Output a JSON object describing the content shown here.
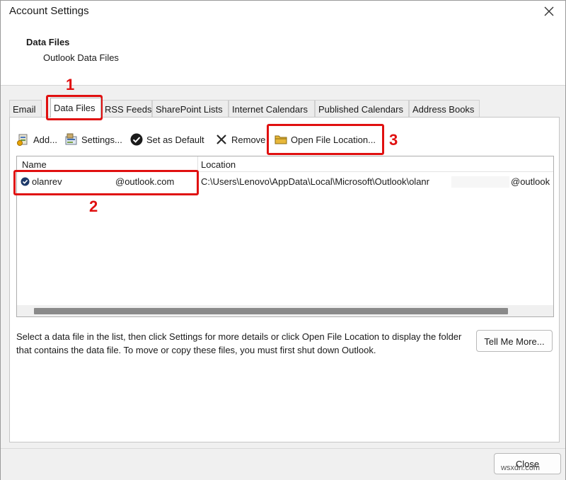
{
  "window": {
    "title": "Account Settings"
  },
  "header": {
    "title": "Data Files",
    "subtitle": "Outlook Data Files"
  },
  "tabs": [
    {
      "label": "Email"
    },
    {
      "label": "Data Files",
      "active": true
    },
    {
      "label": "RSS Feeds"
    },
    {
      "label": "SharePoint Lists"
    },
    {
      "label": "Internet Calendars"
    },
    {
      "label": "Published Calendars"
    },
    {
      "label": "Address Books"
    }
  ],
  "toolbar": {
    "add": "Add...",
    "settings": "Settings...",
    "set_default": "Set as Default",
    "remove": "Remove",
    "open_location": "Open File Location..."
  },
  "list": {
    "columns": [
      "Name",
      "Location"
    ],
    "rows": [
      {
        "name_start": "olanrev",
        "name_end": "@outlook.com",
        "location_start": "C:\\Users\\Lenovo\\AppData\\Local\\Microsoft\\Outlook\\olanr",
        "location_end": "@outlook"
      }
    ]
  },
  "description": "Select a data file in the list, then click Settings for more details or click Open File Location to display the folder that contains the data file. To move or copy these files, you must first shut down Outlook.",
  "buttons": {
    "tell_more": "Tell Me More...",
    "close": "Close"
  },
  "annotations": {
    "callout_1": "1",
    "callout_2": "2",
    "callout_3": "3",
    "accent_color": "#e01010"
  },
  "watermark": "wsxdn.com",
  "icons": {
    "close": "close-icon",
    "add": "add-datafile-icon",
    "settings": "settings-icon",
    "set_default": "checkmark-circle-icon",
    "remove": "remove-x-icon",
    "open_location": "folder-icon",
    "default_marker": "default-check-icon"
  }
}
